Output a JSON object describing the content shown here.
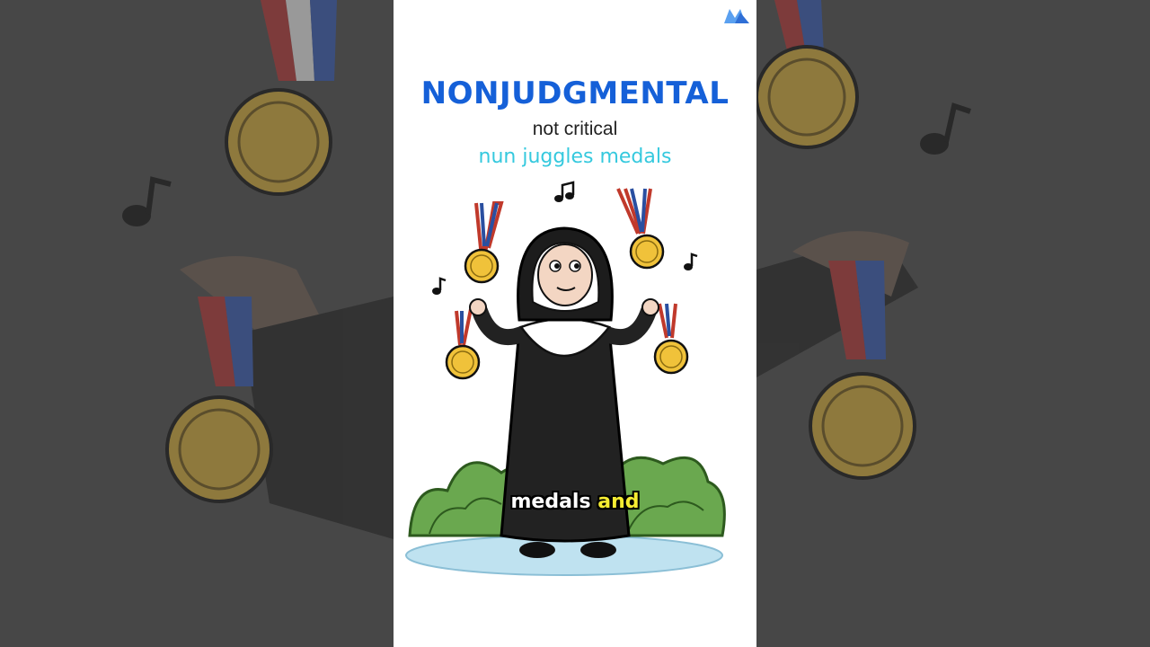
{
  "card": {
    "word": "NONJUDGMENTAL",
    "meaning": "not critical",
    "mnemonic": "nun juggles medals"
  },
  "caption": {
    "word1": "medals",
    "word2": "and"
  },
  "icons": {
    "logo": "brand-logo-icon",
    "note": "music-note-icon",
    "medal": "medal-icon"
  },
  "colors": {
    "word": "#1560d8",
    "mnemonic": "#35c9de",
    "highlight": "#f5ec32",
    "medal": "#e0b530"
  }
}
